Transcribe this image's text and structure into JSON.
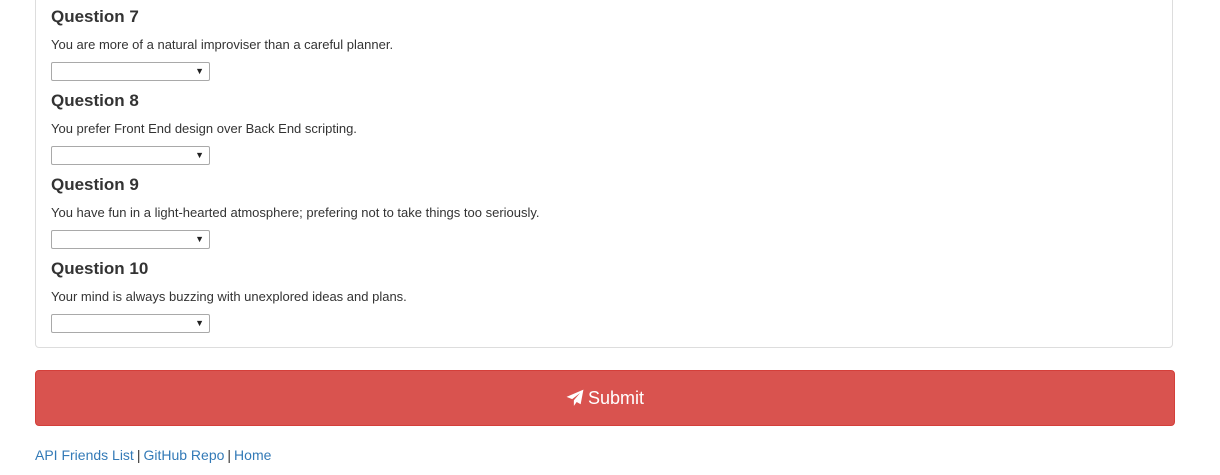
{
  "questions": [
    {
      "title": "Question 7",
      "text": "You are more of a natural improviser than a careful planner.",
      "selected": ""
    },
    {
      "title": "Question 8",
      "text": "You prefer Front End design over Back End scripting.",
      "selected": ""
    },
    {
      "title": "Question 9",
      "text": "You have fun in a light-hearted atmosphere; prefering not to take things too seriously.",
      "selected": ""
    },
    {
      "title": "Question 10",
      "text": "Your mind is always buzzing with unexplored ideas and plans.",
      "selected": ""
    }
  ],
  "submit": {
    "label": "Submit",
    "icon": "paper-plane-icon",
    "color": "#d9534f"
  },
  "footer": {
    "links": [
      "API Friends List",
      "GitHub Repo",
      "Home"
    ],
    "separator": "|",
    "link_color": "#337ab7"
  }
}
